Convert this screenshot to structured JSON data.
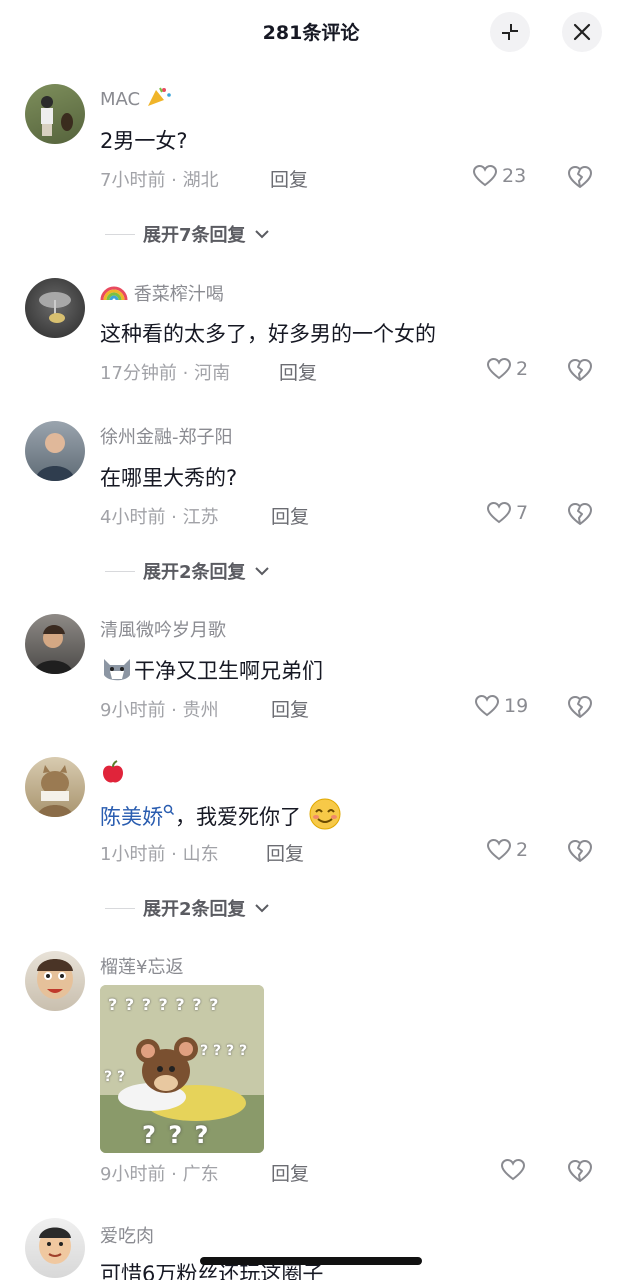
{
  "header": {
    "title": "281条评论"
  },
  "comments": [
    {
      "username": "MAC",
      "text": "2男一女?",
      "meta": "7小时前 · 湖北",
      "reply_label": "回复",
      "likes": "23"
    },
    {
      "username": "香菜榨汁喝",
      "text": "这种看的太多了，好多男的一个女的",
      "meta": "17分钟前 · 河南",
      "reply_label": "回复",
      "likes": "2"
    },
    {
      "username": "徐州金融-郑子阳",
      "text": "在哪里大秀的?",
      "meta": "4小时前 · 江苏",
      "reply_label": "回复",
      "likes": "7"
    },
    {
      "username": "清風微吟岁月歌",
      "text": "干净又卫生啊兄弟们",
      "meta": "9小时前 · 贵州",
      "reply_label": "回复",
      "likes": "19"
    },
    {
      "username": "",
      "mention": "陈美娇",
      "text": "，我爱死你了",
      "meta": "1小时前 · 山东",
      "reply_label": "回复",
      "likes": "2"
    },
    {
      "username": "榴莲¥忘返",
      "meta": "9小时前 · 广东",
      "reply_label": "回复",
      "likes": ""
    },
    {
      "username": "爱吃肉",
      "text": "可惜6万粉丝还玩这圈子"
    }
  ],
  "expanders": [
    {
      "label": "展开7条回复"
    },
    {
      "label": "展开2条回复"
    },
    {
      "label": "展开2条回复"
    }
  ],
  "meme": {
    "marks": [
      "? ? ? ? ? ? ?",
      "? ? ? ?",
      "? ?",
      "? ? ?"
    ]
  },
  "colors": {
    "mention": "#2a5db0",
    "meta": "#a1a2a7"
  }
}
